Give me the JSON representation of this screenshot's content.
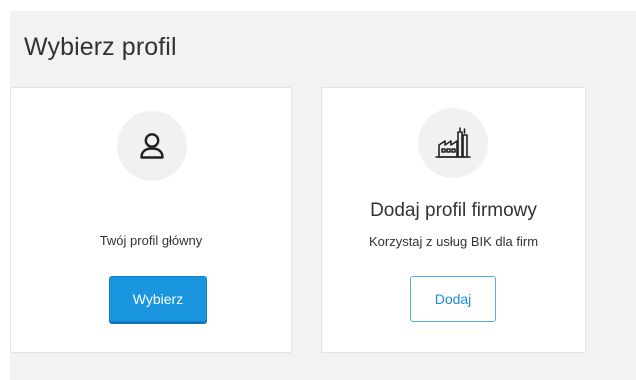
{
  "page": {
    "title": "Wybierz profil"
  },
  "cards": {
    "primary": {
      "icon": "user-icon",
      "text": "Twój profil główny",
      "button_label": "Wybierz"
    },
    "company": {
      "icon": "factory-icon",
      "heading": "Dodaj profil firmowy",
      "text": "Korzystaj z usług BIK dla firm",
      "button_label": "Dodaj"
    }
  },
  "colors": {
    "panel_background": "#f2f2f2",
    "card_background": "#ffffff",
    "accent": "#1a95e0",
    "icon_circle": "#f1f1f1"
  }
}
